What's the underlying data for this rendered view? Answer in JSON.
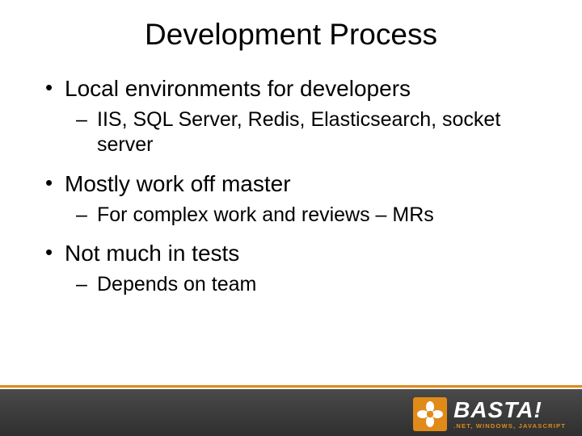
{
  "title": "Development Process",
  "bullets": [
    {
      "text": "Local environments for developers",
      "sub": [
        "IIS, SQL Server, Redis, Elasticsearch, socket server"
      ]
    },
    {
      "text": "Mostly work off master",
      "sub": [
        "For complex work and reviews – MRs"
      ]
    },
    {
      "text": "Not much in tests",
      "sub": [
        "Depends on team"
      ]
    }
  ],
  "logo": {
    "main": "BASTA!",
    "sub": ".NET, WINDOWS, JAVASCRIPT"
  }
}
